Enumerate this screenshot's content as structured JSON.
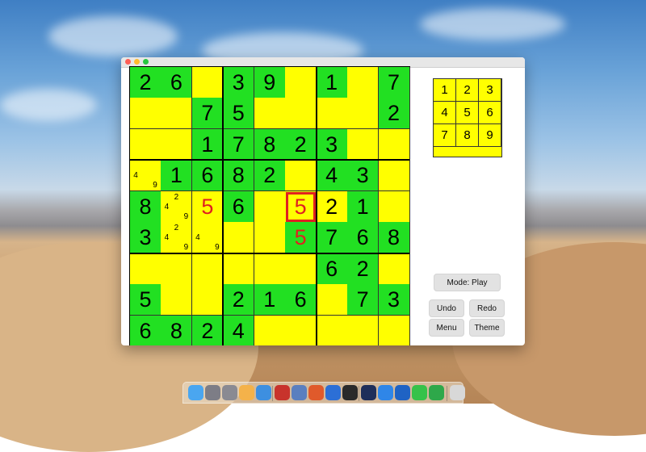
{
  "board": {
    "grid": [
      [
        "2",
        "6",
        "",
        "3",
        "9",
        "",
        "1",
        "",
        "7"
      ],
      [
        "",
        "",
        "7",
        "5",
        "",
        "",
        "",
        "",
        "2"
      ],
      [
        "",
        "",
        "1",
        "7",
        "8",
        "2",
        "3",
        "",
        ""
      ],
      [
        "",
        "1",
        "6",
        "8",
        "2",
        "",
        "4",
        "3",
        ""
      ],
      [
        "8",
        "",
        "5",
        "6",
        "",
        "5",
        "2",
        "1",
        ""
      ],
      [
        "3",
        "",
        "",
        "",
        "",
        "5",
        "7",
        "6",
        "8"
      ],
      [
        "",
        "",
        "",
        "",
        "",
        "",
        "6",
        "2",
        ""
      ],
      [
        "5",
        "",
        "",
        "2",
        "1",
        "6",
        "",
        "7",
        "3"
      ],
      [
        "6",
        "8",
        "2",
        "4",
        "",
        "",
        "",
        "",
        ""
      ]
    ],
    "fill": [
      [
        "g",
        "g",
        "y",
        "g",
        "g",
        "y",
        "g",
        "y",
        "g"
      ],
      [
        "y",
        "y",
        "g",
        "g",
        "y",
        "y",
        "y",
        "y",
        "g"
      ],
      [
        "y",
        "y",
        "g",
        "g",
        "g",
        "g",
        "g",
        "y",
        "y"
      ],
      [
        "y",
        "g",
        "g",
        "g",
        "g",
        "y",
        "g",
        "g",
        "y"
      ],
      [
        "g",
        "y",
        "y",
        "g",
        "y",
        "y",
        "y",
        "g",
        "y"
      ],
      [
        "g",
        "y",
        "y",
        "y",
        "y",
        "g",
        "g",
        "g",
        "g"
      ],
      [
        "y",
        "y",
        "y",
        "y",
        "y",
        "y",
        "g",
        "g",
        "y"
      ],
      [
        "g",
        "y",
        "y",
        "g",
        "g",
        "g",
        "y",
        "g",
        "g"
      ],
      [
        "g",
        "g",
        "g",
        "g",
        "y",
        "y",
        "y",
        "y",
        "y"
      ]
    ],
    "red_cells": [
      [
        4,
        2
      ],
      [
        4,
        5
      ],
      [
        5,
        5
      ]
    ],
    "selected_cell": [
      4,
      5
    ],
    "notes": [
      {
        "row": 3,
        "col": 0,
        "marks": [
          "4",
          "9"
        ]
      },
      {
        "row": 4,
        "col": 1,
        "marks": [
          "2",
          "4",
          "9"
        ]
      },
      {
        "row": 5,
        "col": 1,
        "marks": [
          "2",
          "4",
          "9"
        ]
      },
      {
        "row": 5,
        "col": 2,
        "marks": [
          "4",
          "9"
        ]
      }
    ]
  },
  "palette": {
    "digits": [
      "1",
      "2",
      "3",
      "4",
      "5",
      "6",
      "7",
      "8",
      "9"
    ]
  },
  "controls": {
    "mode_label": "Mode: Play",
    "undo_label": "Undo",
    "redo_label": "Redo",
    "menu_label": "Menu",
    "theme_label": "Theme"
  },
  "colors": {
    "green": "#22e022",
    "yellow": "#ffff00",
    "conflict_red": "#e02020"
  },
  "dock": {
    "icons": [
      "finder-icon",
      "launchpad-icon",
      "system-preferences-icon",
      "photos-icon",
      "safari-icon",
      "filezilla-icon",
      "network-icon",
      "browser-icon",
      "xcode-icon",
      "activity-monitor-icon",
      "instruments-icon",
      "app-store-icon",
      "outlook-icon",
      "messages-icon",
      "numbers-icon",
      "trash-icon"
    ]
  }
}
